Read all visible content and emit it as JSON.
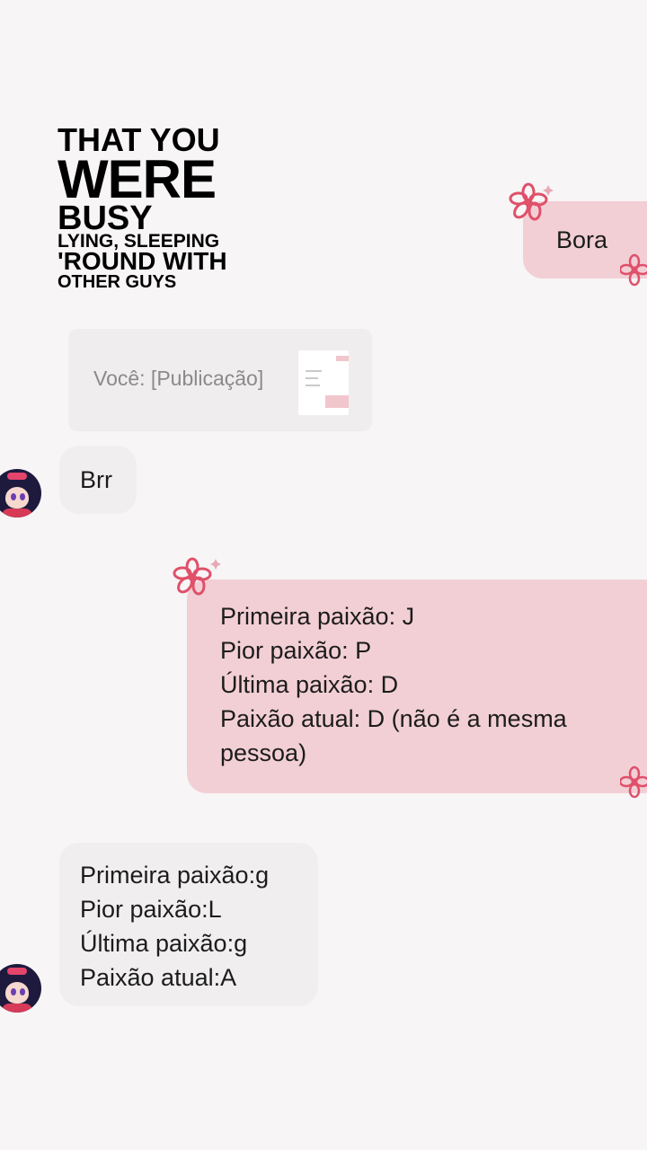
{
  "lyrics": {
    "line1": "THAT YOU",
    "line2": "WERE",
    "line3": "BUSY",
    "line4": "LYING, SLEEPING",
    "line5": "'ROUND WITH",
    "line6": "OTHER GUYS"
  },
  "chat": {
    "sent_bora": "Bora",
    "shared_post": "Você: [Publicação]",
    "received_brr": "Brr",
    "sent_list": [
      "Primeira paixão: J",
      "Pior paixão: P",
      "Última paixão: D",
      "Paixão atual: D (não é a mesma",
      "pessoa)"
    ],
    "received_list": [
      "Primeira paixão:g",
      "Pior paixão:L",
      "Última paixão:g",
      "Paixão atual:A"
    ]
  },
  "colors": {
    "sent_bubble": "#f2cfd5",
    "received_bubble": "#f0eeef",
    "flower": "#e0506a",
    "background": "#f7f5f6"
  }
}
